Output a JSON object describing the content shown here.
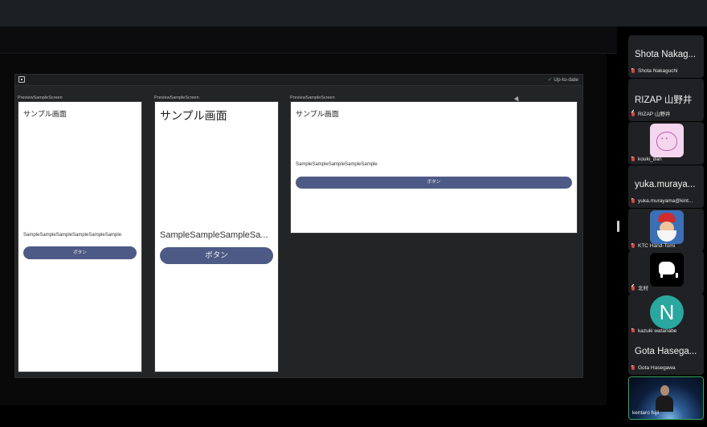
{
  "ide": {
    "status": "Up-to-date",
    "previews": [
      {
        "title": "PreviewSampleScreen",
        "heading": "サンプル画面",
        "body": "SampleSampleSampleSampleSampleSample",
        "button": "ボタン"
      },
      {
        "title": "PreviewSampleScreen",
        "heading": "サンプル画面",
        "body": "SampleSampleSampleSa...",
        "button": "ボタン"
      },
      {
        "title": "PreviewSampleScreen",
        "heading": "サンプル画面",
        "body": "SampleSampleSampleSampleSample",
        "button": "ボタン"
      }
    ]
  },
  "participants": [
    {
      "name": "Shota Nakag...",
      "label": "Shota Nakaguchi"
    },
    {
      "name": "RIZAP 山野井",
      "label": "RIZAP 山野井"
    },
    {
      "avatar": "pink-blob-avatar",
      "label": "kouki_dan"
    },
    {
      "name": "yuka.muraya...",
      "label": "yuka.murayama@kint..."
    },
    {
      "avatar": "santa-avatar",
      "label": "KTC Hand-Tomi"
    },
    {
      "avatar": "pixel-dog-avatar",
      "label": "北村"
    },
    {
      "avatar": "n-avatar",
      "initial": "N",
      "label": "kazuki watanabe"
    },
    {
      "name": "Gota Hasega...",
      "label": "Gota Hasegawa"
    }
  ],
  "active_speaker": {
    "label": "kentaro fujii"
  },
  "colors": {
    "button": "#4e5a86",
    "mic_muted": "#d94545",
    "active_border": "#3aa55a"
  }
}
